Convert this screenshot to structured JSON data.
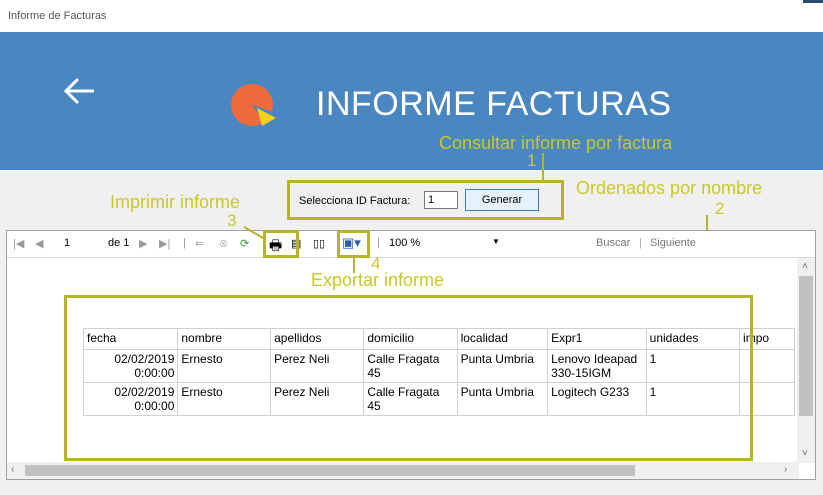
{
  "window": {
    "title": "Informe de Facturas"
  },
  "header": {
    "title": "INFORME FACTURAS"
  },
  "params": {
    "label": "Selecciona ID Factura:",
    "value": "1",
    "button": "Generar"
  },
  "toolbar": {
    "page": "1",
    "of_label": "de 1",
    "zoom": "100 %",
    "find": "Buscar",
    "next": "Siguiente"
  },
  "annotations": {
    "a1": "Consultar informe por factura",
    "n1": "1",
    "a2": "Ordenados por nombre",
    "n2": "2",
    "a3": "Imprimir informe",
    "n3": "3",
    "a4": "Exportar informe",
    "n4": "4"
  },
  "table": {
    "headers": [
      "fecha",
      "nombre",
      "apellidos",
      "domicilio",
      "localidad",
      "Expr1",
      "unidades",
      "impo"
    ],
    "rows": [
      {
        "fecha": "02/02/2019 0:00:00",
        "nombre": "Ernesto",
        "apellidos": "Perez Neli",
        "domicilio": "Calle Fragata 45",
        "localidad": "Punta Umbria",
        "expr1": "Lenovo Ideapad 330-15IGM",
        "unidades": "1",
        "importe": ""
      },
      {
        "fecha": "02/02/2019 0:00:00",
        "nombre": "Ernesto",
        "apellidos": "Perez Neli",
        "domicilio": "Calle Fragata 45",
        "localidad": "Punta Umbria",
        "expr1": "Logitech G233",
        "unidades": "1",
        "importe": ""
      }
    ]
  },
  "colors": {
    "header_bg": "#4a86c0",
    "annotation": "#c8c82a",
    "logo_orange": "#f06a3c",
    "logo_yellow": "#f5d21c"
  },
  "icons": [
    "back-arrow-icon",
    "pie-chart-logo-icon",
    "first-page-icon",
    "prev-page-icon",
    "next-page-icon",
    "last-page-icon",
    "back-icon",
    "stop-icon",
    "refresh-icon",
    "print-icon",
    "print-layout-icon",
    "page-setup-icon",
    "export-icon"
  ]
}
